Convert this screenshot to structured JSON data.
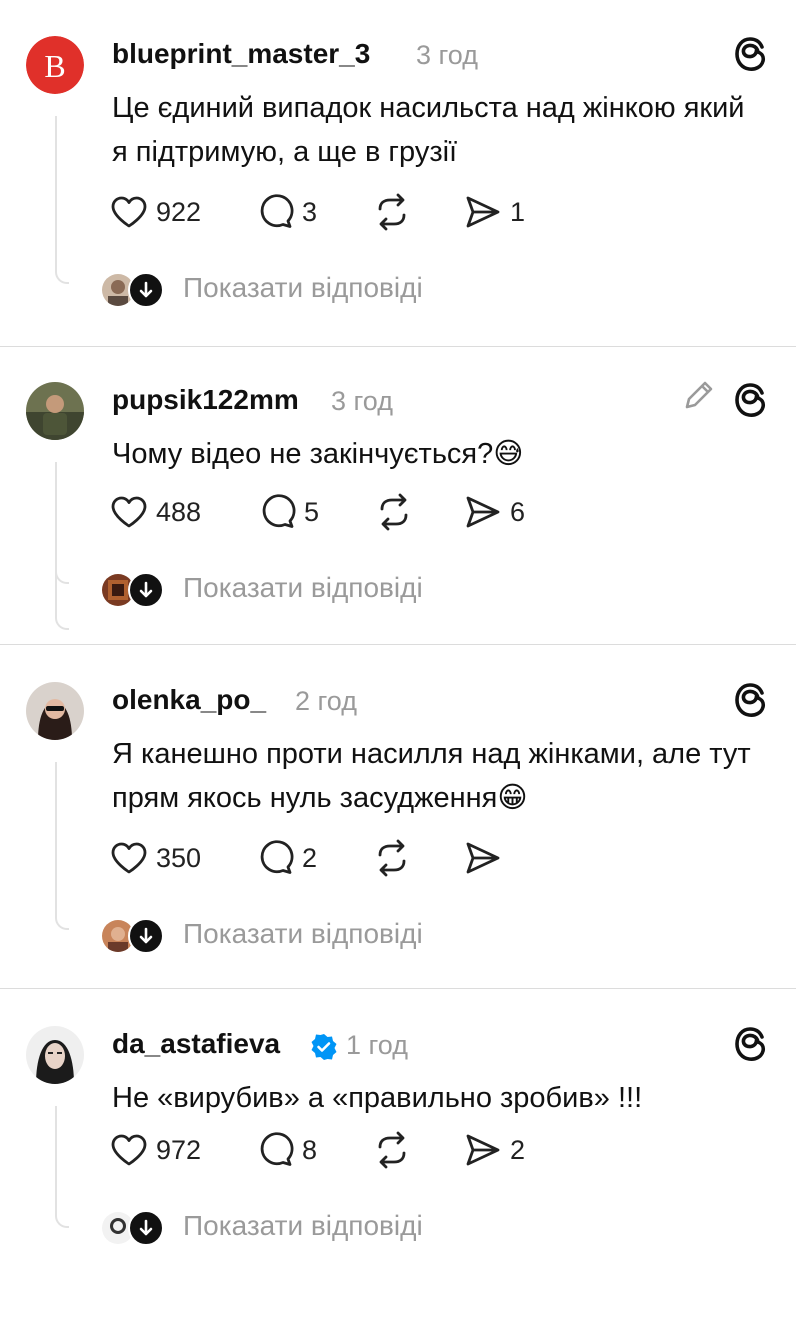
{
  "posts": [
    {
      "username": "blueprint_master_3",
      "time": "3 год",
      "text": "Це єдиний випадок насильста над жінкою який я підтримую, а ще в грузії",
      "likes": "922",
      "comments": "3",
      "reposts": "",
      "shares": "1",
      "avatar_letter": "B",
      "show_replies": "Показати відповіді"
    },
    {
      "username": "pupsik122mm",
      "time": "3 год",
      "text": "Чому відео не закінчується?😅",
      "likes": "488",
      "comments": "5",
      "reposts": "",
      "shares": "6",
      "show_replies": "Показати відповіді"
    },
    {
      "username": "olenka_po_",
      "time": "2 год",
      "text": "Я канешно проти насилля над жінками, але тут прям якось нуль засудження😁",
      "likes": "350",
      "comments": "2",
      "reposts": "",
      "shares": "",
      "show_replies": "Показати відповіді"
    },
    {
      "username": "da_astafieva",
      "time": "1 год",
      "text": "Не «вирубив» а «правильно зробив» !!!",
      "likes": "972",
      "comments": "8",
      "reposts": "",
      "shares": "2",
      "show_replies": "Показати відповіді"
    }
  ],
  "colors": {
    "brand_red": "#e0302a",
    "verified_blue": "#0095f6",
    "muted_text": "#9a9a9a"
  },
  "icons": [
    "threads-icon",
    "heart-icon",
    "comment-icon",
    "repost-icon",
    "share-icon",
    "edit-icon",
    "verified-icon",
    "download-arrow-icon"
  ]
}
